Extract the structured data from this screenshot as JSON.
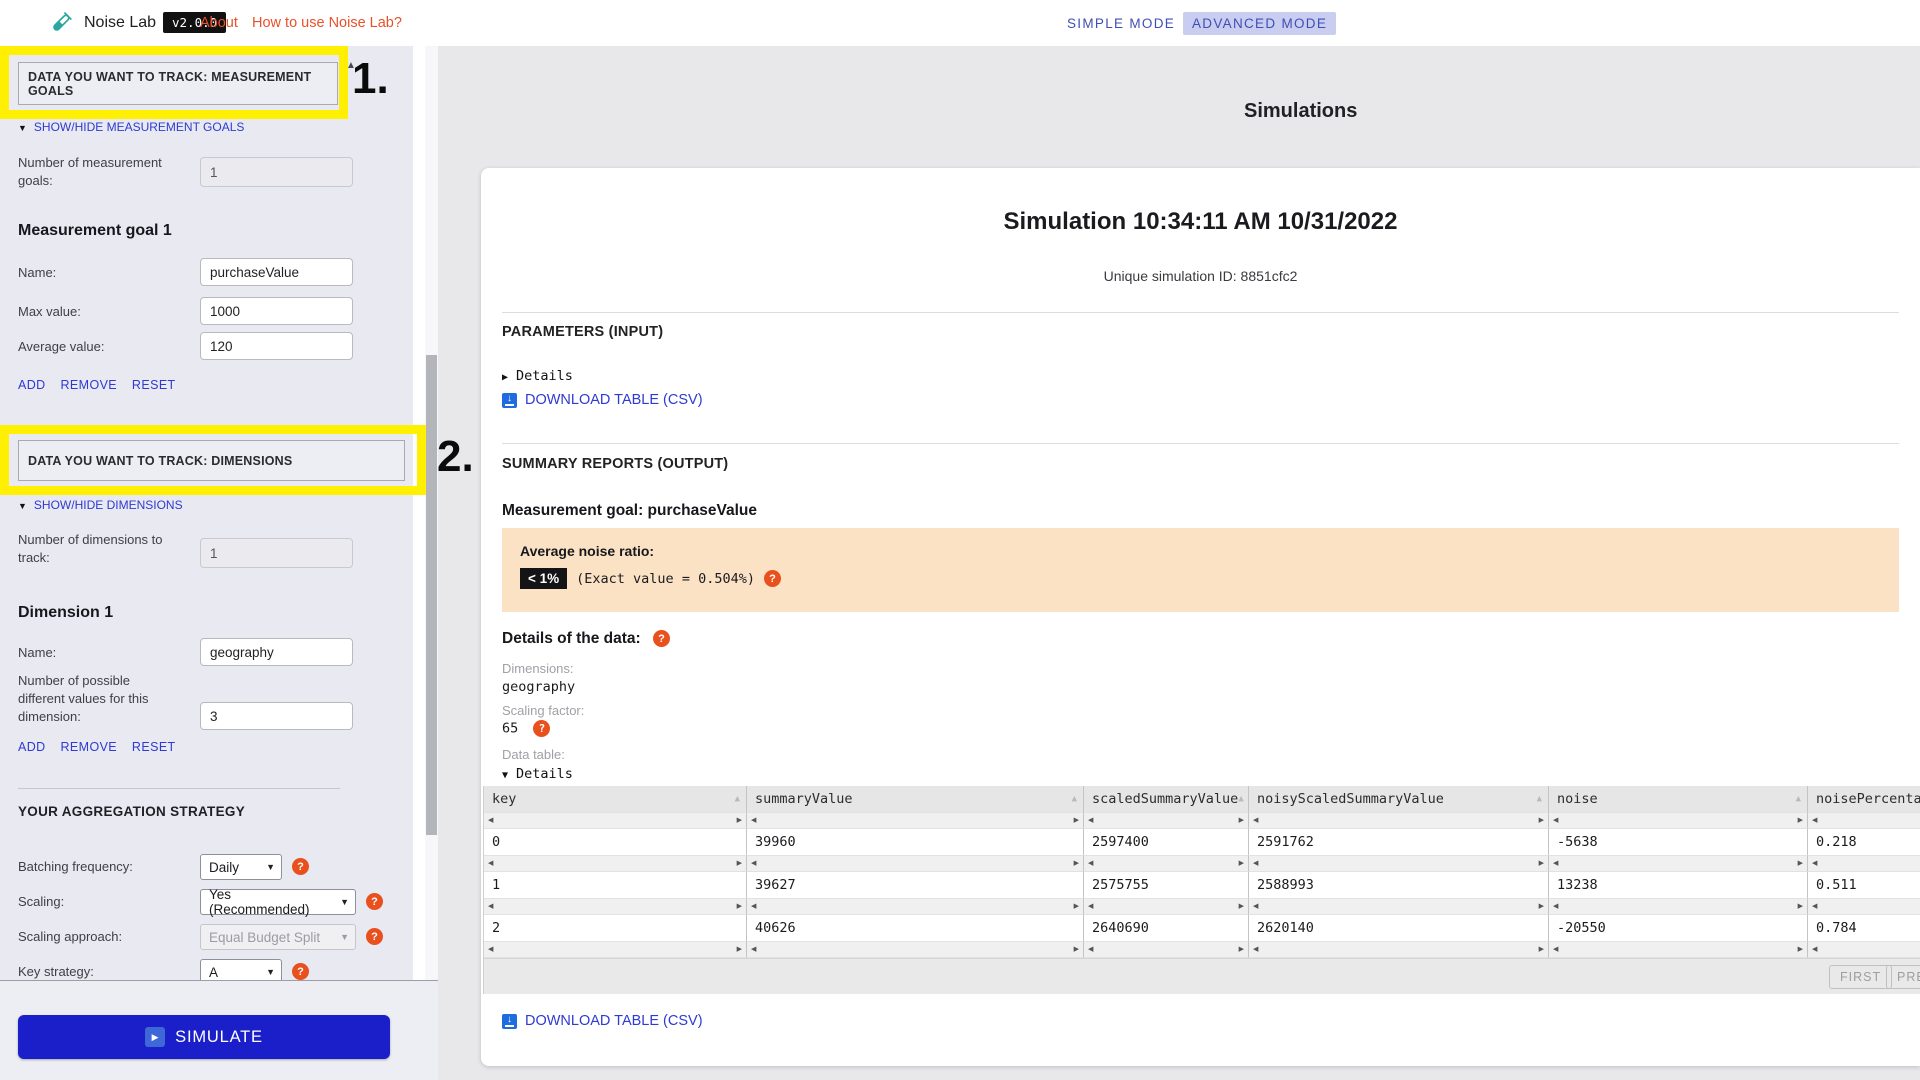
{
  "topbar": {
    "app_title": "Noise Lab",
    "version": "v2.0.0",
    "about": "About",
    "how_to": "How to use Noise Lab?",
    "simple_mode": "SIMPLE MODE",
    "advanced_mode": "ADVANCED MODE"
  },
  "annotations": {
    "one": "1.",
    "two": "2."
  },
  "sidebar": {
    "goals": {
      "header": "DATA YOU WANT TO TRACK: MEASUREMENT GOALS",
      "toggle": "SHOW/HIDE MEASUREMENT GOALS",
      "count_label": "Number of measurement goals:",
      "count_value": "1",
      "goal_title": "Measurement goal 1",
      "name_label": "Name:",
      "name_value": "purchaseValue",
      "max_label": "Max value:",
      "max_value": "1000",
      "avg_label": "Average value:",
      "avg_value": "120",
      "add": "ADD",
      "remove": "REMOVE",
      "reset": "RESET"
    },
    "dimensions": {
      "header": "DATA YOU WANT TO TRACK: DIMENSIONS",
      "toggle": "SHOW/HIDE DIMENSIONS",
      "count_label": "Number of dimensions to track:",
      "count_value": "1",
      "dim_title": "Dimension 1",
      "name_label": "Name:",
      "name_value": "geography",
      "values_label": "Number of possible different values for this dimension:",
      "values_value": "3",
      "add": "ADD",
      "remove": "REMOVE",
      "reset": "RESET"
    },
    "strategy": {
      "header": "YOUR AGGREGATION STRATEGY",
      "batching_label": "Batching frequency:",
      "batching_value": "Daily",
      "scaling_label": "Scaling:",
      "scaling_value": "Yes (Recommended)",
      "approach_label": "Scaling approach:",
      "approach_value": "Equal Budget Split",
      "key_label": "Key strategy:",
      "key_value": "A"
    },
    "simulate_label": "SIMULATE"
  },
  "main": {
    "title": "Simulations",
    "card": {
      "heading": "Simulation 10:34:11 AM 10/31/2022",
      "sim_id": "Unique simulation ID: 8851cfc2",
      "params_header": "PARAMETERS (INPUT)",
      "details_collapsed": "Details",
      "download_top": "DOWNLOAD TABLE (CSV)",
      "summary_header": "SUMMARY REPORTS (OUTPUT)",
      "goal_line": "Measurement goal: purchaseValue",
      "noise": {
        "label": "Average noise ratio:",
        "badge": "< 1%",
        "exact": "(Exact value = 0.504%)"
      },
      "details_data_header": "Details of the data:",
      "dims_label": "Dimensions:",
      "dims_value": "geography",
      "scaling_label": "Scaling factor:",
      "scaling_value": "65",
      "table_label": "Data table:",
      "details_expanded": "Details",
      "download_bottom": "DOWNLOAD TABLE (CSV)"
    }
  },
  "table": {
    "columns": [
      "key",
      "summaryValue",
      "scaledSummaryValue",
      "noisyScaledSummaryValue",
      "noise",
      "noisePercentage"
    ],
    "rows": [
      [
        "0",
        "39960",
        "2597400",
        "2591762",
        "-5638",
        "0.218"
      ],
      [
        "1",
        "39627",
        "2575755",
        "2588993",
        "13238",
        "0.511"
      ],
      [
        "2",
        "40626",
        "2640690",
        "2620140",
        "-20550",
        "0.784"
      ]
    ],
    "footer": {
      "first": "FIRST",
      "prev": "PREV"
    }
  },
  "colors": {
    "highlight": "#ffef00",
    "link_blue": "#2e3ad1",
    "nav_orange": "#e8512a",
    "simulate_blue": "#1a1fc9",
    "mode_indigo": "#3f4fb5",
    "noise_box_peach": "#fbe2c5",
    "badge_black": "#141417"
  }
}
